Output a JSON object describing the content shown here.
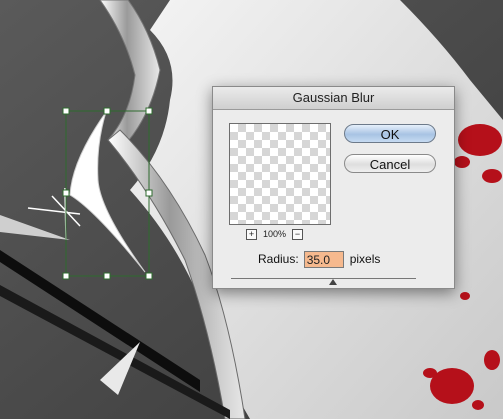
{
  "dialog": {
    "title": "Gaussian Blur",
    "ok_label": "OK",
    "cancel_label": "Cancel",
    "zoom_level": "100%",
    "zoom_in_symbol": "+",
    "zoom_out_symbol": "−",
    "radius_label": "Radius:",
    "radius_value": "35.0",
    "radius_unit": "pixels",
    "radius_field_color": "#f6b98e"
  },
  "canvas": {
    "selection_color": "#2e6b2e",
    "blood_color": "#b5101a"
  },
  "icons": [
    "zoom-in-icon",
    "zoom-out-icon",
    "slider-thumb-icon",
    "transform-handle-icon"
  ]
}
